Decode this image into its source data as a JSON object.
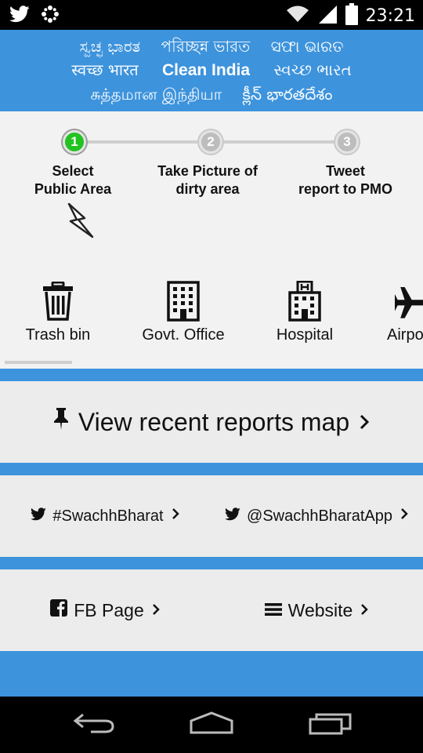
{
  "status_bar": {
    "time": "23:21",
    "icons": [
      "twitter-icon",
      "dots-icon",
      "wifi-icon",
      "signal-icon",
      "battery-icon"
    ]
  },
  "banner": {
    "line1": [
      "ಸ್ವಚ್ಛ ಭಾರತ",
      "পরিচ্ছন্ন ভারত",
      "ସଫା ଭାରତ"
    ],
    "line2": [
      "स्वच्छ भारत",
      "Clean India",
      "સ્વચ્છ ભારત"
    ],
    "line3": [
      "சுத்தமான இந்தியா",
      "క్లీన్ భారతదేశం"
    ]
  },
  "steps": [
    {
      "number": "1",
      "line1": "Select",
      "line2": "Public Area",
      "active": true
    },
    {
      "number": "2",
      "line1": "Take Picture of",
      "line2": "dirty area",
      "active": false
    },
    {
      "number": "3",
      "line1": "Tweet",
      "line2": "report to PMO",
      "active": false
    }
  ],
  "categories": [
    {
      "label": "Trash bin",
      "icon": "trash-bin-icon"
    },
    {
      "label": "Govt. Office",
      "icon": "office-building-icon"
    },
    {
      "label": "Hospital",
      "icon": "hospital-icon"
    },
    {
      "label": "Airport",
      "icon": "airplane-icon"
    }
  ],
  "actions": {
    "map_label": "View recent reports map",
    "twitter_hashtag": "#SwachhBharat",
    "twitter_handle": "@SwachhBharatApp",
    "fb_label": "FB Page",
    "website_label": "Website"
  },
  "colors": {
    "brand_blue": "#3d93dc",
    "active_step": "#22c321",
    "panel_bg": "#ececec"
  }
}
